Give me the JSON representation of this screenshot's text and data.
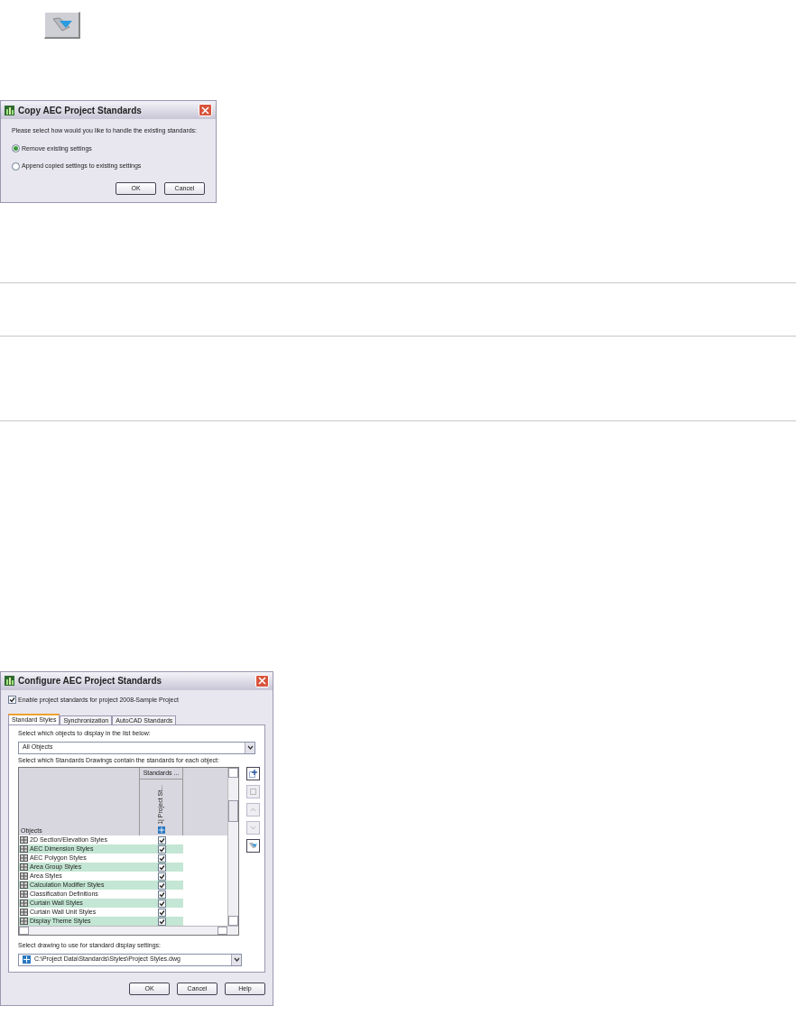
{
  "copy_dialog": {
    "title": "Copy AEC Project Standards",
    "prompt": "Please select how would you like to handle the existing standards:",
    "options": [
      {
        "label": "Remove existing settings",
        "selected": true
      },
      {
        "label": "Append copied settings to existing settings",
        "selected": false
      }
    ],
    "buttons": [
      "OK",
      "Cancel"
    ]
  },
  "configure_dialog": {
    "title": "Configure AEC Project Standards",
    "enable": {
      "label": "Enable project standards for project 2008-Sample Project",
      "checked": true
    },
    "tabs": [
      {
        "label": "Standard Styles",
        "selected": true
      },
      {
        "label": "Synchronization",
        "selected": false
      },
      {
        "label": "AutoCAD Standards",
        "selected": false
      }
    ],
    "objects_label": "Select which objects to display in the list below:",
    "objects_dropdown": {
      "value": "All Objects"
    },
    "drawings_label": "Select which Standards Drawings contain the standards for each object:",
    "table": {
      "objects_header": "Objects",
      "group_header": "Standards ...",
      "drawing_header": "1| Project St...",
      "rows": [
        {
          "name": "2D Section/Elevation Styles",
          "checked": true
        },
        {
          "name": "AEC Dimension Styles",
          "checked": true
        },
        {
          "name": "AEC Polygon Styles",
          "checked": true
        },
        {
          "name": "Area Group Styles",
          "checked": true
        },
        {
          "name": "Area Styles",
          "checked": true
        },
        {
          "name": "Calculation Modifier Styles",
          "checked": true
        },
        {
          "name": "Classification Definitions",
          "checked": true
        },
        {
          "name": "Curtain Wall Styles",
          "checked": true
        },
        {
          "name": "Curtain Wall Unit Styles",
          "checked": true
        },
        {
          "name": "Display Theme Styles",
          "checked": true
        }
      ]
    },
    "display_label": "Select drawing to use for standard display settings:",
    "display_dropdown": {
      "value": "C:\\Project Data\\Standards\\Styles\\Project Styles.dwg"
    },
    "buttons": [
      "OK",
      "Cancel",
      "Help"
    ]
  }
}
